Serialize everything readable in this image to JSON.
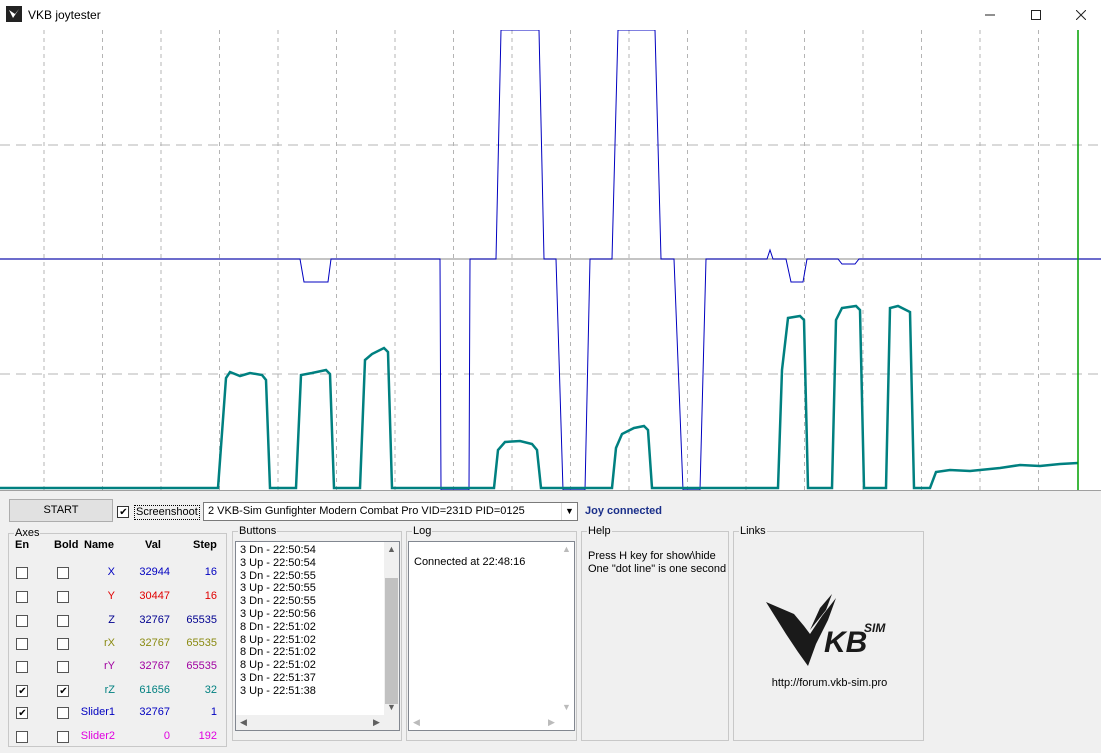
{
  "window": {
    "title": "VKB joytester",
    "controls": [
      "minimize",
      "maximize",
      "close"
    ]
  },
  "toolbar": {
    "start_label": "START",
    "screenshoot_label": "Screenshoot",
    "screenshoot_checked": true,
    "device": "2  VKB-Sim Gunfighter Modern Combat Pro  VID=231D PID=0125",
    "status": "Joy connected"
  },
  "axes": {
    "group_title": "Axes",
    "headers": {
      "en": "En",
      "bold": "Bold",
      "name": "Name",
      "val": "Val",
      "step": "Step"
    },
    "rows": [
      {
        "en": false,
        "bold": false,
        "name": "X",
        "val": "32944",
        "step": "16",
        "color": "#0000c0"
      },
      {
        "en": false,
        "bold": false,
        "name": "Y",
        "val": "30447",
        "step": "16",
        "color": "#e00000"
      },
      {
        "en": false,
        "bold": false,
        "name": "Z",
        "val": "32767",
        "step": "65535",
        "color": "#000090"
      },
      {
        "en": false,
        "bold": false,
        "name": "rX",
        "val": "32767",
        "step": "65535",
        "color": "#8a8a10"
      },
      {
        "en": false,
        "bold": false,
        "name": "rY",
        "val": "32767",
        "step": "65535",
        "color": "#a000a0"
      },
      {
        "en": true,
        "bold": true,
        "name": "rZ",
        "val": "61656",
        "step": "32",
        "color": "#008080"
      },
      {
        "en": true,
        "bold": false,
        "name": "Slider1",
        "val": "32767",
        "step": "1",
        "color": "#0000c0"
      },
      {
        "en": false,
        "bold": false,
        "name": "Slider2",
        "val": "0",
        "step": "192",
        "color": "#e000e0"
      }
    ]
  },
  "buttons": {
    "group_title": "Buttons",
    "lines": [
      "3 Dn - 22:50:54",
      "3 Up - 22:50:54",
      "3 Dn - 22:50:55",
      "3 Up - 22:50:55",
      "3 Dn - 22:50:55",
      "3 Up - 22:50:56",
      "8 Dn - 22:51:02",
      "8 Up - 22:51:02",
      "8 Dn - 22:51:02",
      "8 Up - 22:51:02",
      "3 Dn - 22:51:37",
      "3 Up - 22:51:38"
    ]
  },
  "log": {
    "group_title": "Log",
    "lines": [
      "Connected at 22:48:16"
    ]
  },
  "help": {
    "group_title": "Help",
    "line1": "Press H key for show\\hide",
    "line2": "One \"dot line\" is one second"
  },
  "links": {
    "group_title": "Links",
    "url": "http://forum.vkb-sim.pro",
    "logo_text": "KB",
    "logo_sub": "SIM"
  },
  "chart_colors": {
    "x_axis": "#0000c0",
    "rz_axis": "#008080",
    "cursor": "#00a000",
    "grid": "#b4b4b4"
  }
}
